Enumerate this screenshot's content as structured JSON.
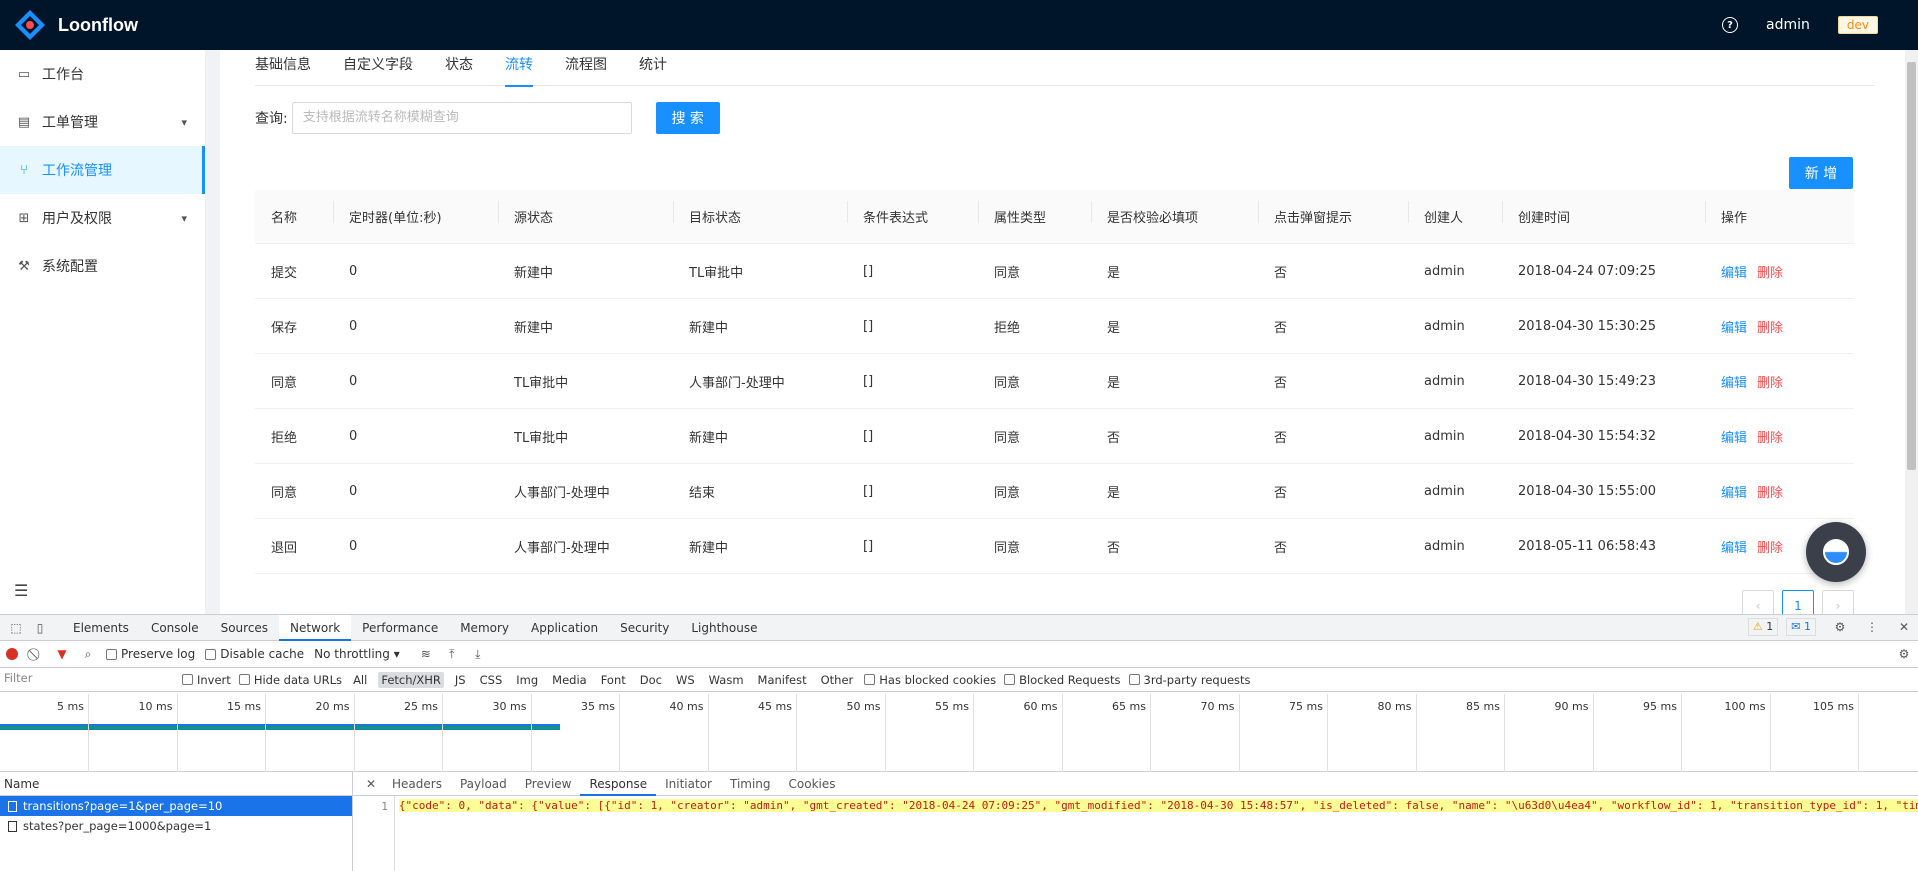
{
  "app": {
    "name": "Loonflow",
    "user": "admin",
    "env_badge": "dev",
    "help_icon": "question-circle-icon"
  },
  "sidebar": {
    "items": [
      {
        "label": "工作台",
        "icon": "dashboard-icon"
      },
      {
        "label": "工单管理",
        "icon": "ticket-icon",
        "has_children": true
      },
      {
        "label": "工作流管理",
        "icon": "workflow-icon",
        "active": true
      },
      {
        "label": "用户及权限",
        "icon": "user-tree-icon",
        "has_children": true
      },
      {
        "label": "系统配置",
        "icon": "wrench-icon"
      }
    ],
    "collapse_icon": "menu-fold-icon"
  },
  "tabs": [
    {
      "label": "基础信息"
    },
    {
      "label": "自定义字段"
    },
    {
      "label": "状态"
    },
    {
      "label": "流转",
      "active": true
    },
    {
      "label": "流程图"
    },
    {
      "label": "统计"
    }
  ],
  "query": {
    "label": "查询:",
    "placeholder": "支持根据流转名称模糊查询",
    "search_button": "搜 索"
  },
  "add_button": "新 增",
  "table": {
    "columns": [
      "名称",
      "定时器(单位:秒)",
      "源状态",
      "目标状态",
      "条件表达式",
      "属性类型",
      "是否校验必填项",
      "点击弹窗提示",
      "创建人",
      "创建时间",
      "操作"
    ],
    "rows": [
      [
        "提交",
        "0",
        "新建中",
        "TL审批中",
        "[]",
        "同意",
        "是",
        "否",
        "admin",
        "2018-04-24 07:09:25"
      ],
      [
        "保存",
        "0",
        "新建中",
        "新建中",
        "[]",
        "拒绝",
        "是",
        "否",
        "admin",
        "2018-04-30 15:30:25"
      ],
      [
        "同意",
        "0",
        "TL审批中",
        "人事部门-处理中",
        "[]",
        "同意",
        "是",
        "否",
        "admin",
        "2018-04-30 15:49:23"
      ],
      [
        "拒绝",
        "0",
        "TL审批中",
        "新建中",
        "[]",
        "同意",
        "否",
        "否",
        "admin",
        "2018-04-30 15:54:32"
      ],
      [
        "同意",
        "0",
        "人事部门-处理中",
        "结束",
        "[]",
        "同意",
        "是",
        "否",
        "admin",
        "2018-04-30 15:55:00"
      ],
      [
        "退回",
        "0",
        "人事部门-处理中",
        "新建中",
        "[]",
        "同意",
        "否",
        "否",
        "admin",
        "2018-05-11 06:58:43"
      ]
    ],
    "edit_label": "编辑",
    "delete_label": "删除"
  },
  "pagination": {
    "prev": "‹",
    "current": "1",
    "next": "›"
  },
  "devtools": {
    "tabs": [
      "Elements",
      "Console",
      "Sources",
      "Network",
      "Performance",
      "Memory",
      "Application",
      "Security",
      "Lighthouse"
    ],
    "active_tab": "Network",
    "warnings_count": "1",
    "messages_count": "1",
    "toolbar": {
      "preserve_log": "Preserve log",
      "disable_cache": "Disable cache",
      "throttling": "No throttling"
    },
    "filter": {
      "placeholder": "Filter",
      "invert": "Invert",
      "hide_data_urls": "Hide data URLs",
      "types": [
        "All",
        "Fetch/XHR",
        "JS",
        "CSS",
        "Img",
        "Media",
        "Font",
        "Doc",
        "WS",
        "Wasm",
        "Manifest",
        "Other"
      ],
      "active_type": "Fetch/XHR",
      "has_blocked_cookies": "Has blocked cookies",
      "blocked_requests": "Blocked Requests",
      "third_party": "3rd-party requests"
    },
    "timeline_ticks": [
      "5 ms",
      "10 ms",
      "15 ms",
      "20 ms",
      "25 ms",
      "30 ms",
      "35 ms",
      "40 ms",
      "45 ms",
      "50 ms",
      "55 ms",
      "60 ms",
      "65 ms",
      "70 ms",
      "75 ms",
      "80 ms",
      "85 ms",
      "90 ms",
      "95 ms",
      "100 ms",
      "105 ms",
      "11"
    ],
    "requests_header": "Name",
    "requests": [
      {
        "name": "transitions?page=1&per_page=10",
        "selected": true
      },
      {
        "name": "states?per_page=1000&page=1"
      }
    ],
    "detail_tabs": [
      "Headers",
      "Payload",
      "Preview",
      "Response",
      "Initiator",
      "Timing",
      "Cookies"
    ],
    "active_detail_tab": "Response",
    "response_line_number": "1",
    "response_text": "{\"code\": 0, \"data\": {\"value\": [{\"id\": 1, \"creator\": \"admin\", \"gmt_created\": \"2018-04-24 07:09:25\", \"gmt_modified\": \"2018-04-30 15:48:57\", \"is_deleted\": false, \"name\": \"\\u63d0\\u4ea4\", \"workflow_id\": 1, \"transition_type_id\": 1, \"tim"
  },
  "colors": {
    "primary": "#1890ff",
    "danger": "#ff4d4f",
    "header_bg": "#001529"
  }
}
